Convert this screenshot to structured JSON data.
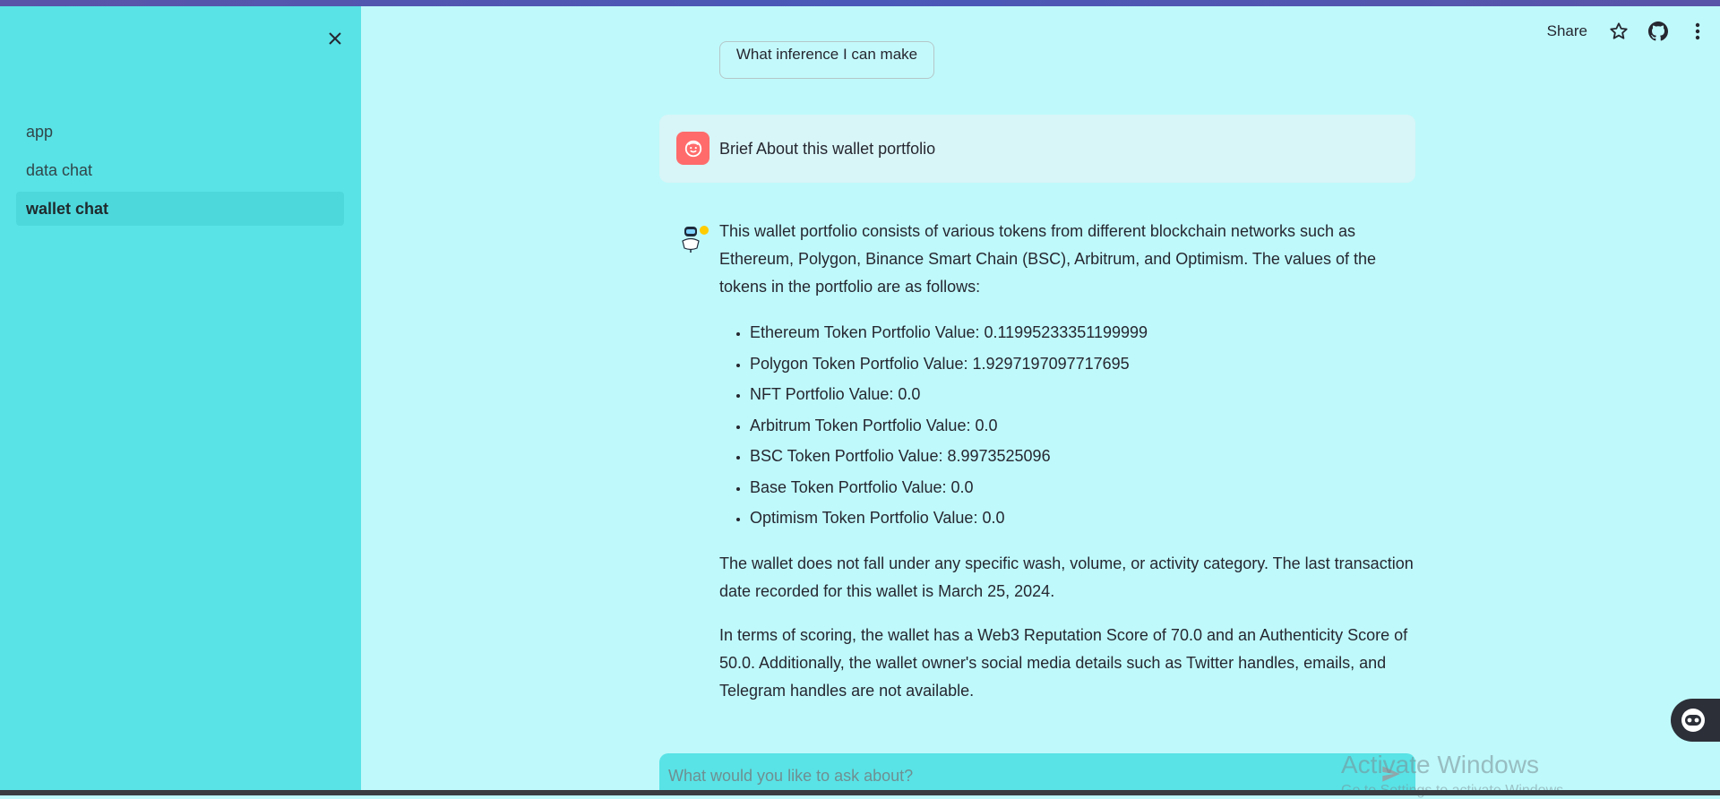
{
  "sidebar": {
    "close_label": "×",
    "items": [
      {
        "label": "app"
      },
      {
        "label": "data chat"
      },
      {
        "label": "wallet chat",
        "active": true
      }
    ]
  },
  "header": {
    "share_label": "Share",
    "icons": [
      "star-icon",
      "github-icon",
      "more-vert-icon"
    ]
  },
  "suggestion_chip": {
    "label": "What inference I can make"
  },
  "user_message": {
    "text": "Brief About this wallet portfolio",
    "avatar_color": "#ff6b6b"
  },
  "assistant_message": {
    "intro": "This wallet portfolio consists of various tokens from different blockchain networks such as Ethereum, Polygon, Binance Smart Chain (BSC), Arbitrum, and Optimism. The values of the tokens in the portfolio are as follows:",
    "items": [
      "Ethereum Token Portfolio Value: 0.11995233351199999",
      "Polygon Token Portfolio Value: 1.9297197097717695",
      "NFT Portfolio Value: 0.0",
      "Arbitrum Token Portfolio Value: 0.0",
      "BSC Token Portfolio Value: 8.9973525096",
      "Base Token Portfolio Value: 0.0",
      "Optimism Token Portfolio Value: 0.0"
    ],
    "paragraph2": "The wallet does not fall under any specific wash, volume, or activity category. The last transaction date recorded for this wallet is March 25, 2024.",
    "paragraph3": "In terms of scoring, the wallet has a Web3 Reputation Score of 70.0 and an Authenticity Score of 50.0. Additionally, the wallet owner's social media details such as Twitter handles, emails, and Telegram handles are not available."
  },
  "chat_input": {
    "placeholder": "What would you like to ask about?",
    "value": ""
  },
  "watermark": {
    "title": "Activate Windows",
    "subtitle": "Go to Settings to activate Windows."
  },
  "colors": {
    "sidebar": "#59e3e6",
    "main": "#bff9fb",
    "user_bubble": "#d8f5f7",
    "accent": "#ff6b6b"
  }
}
